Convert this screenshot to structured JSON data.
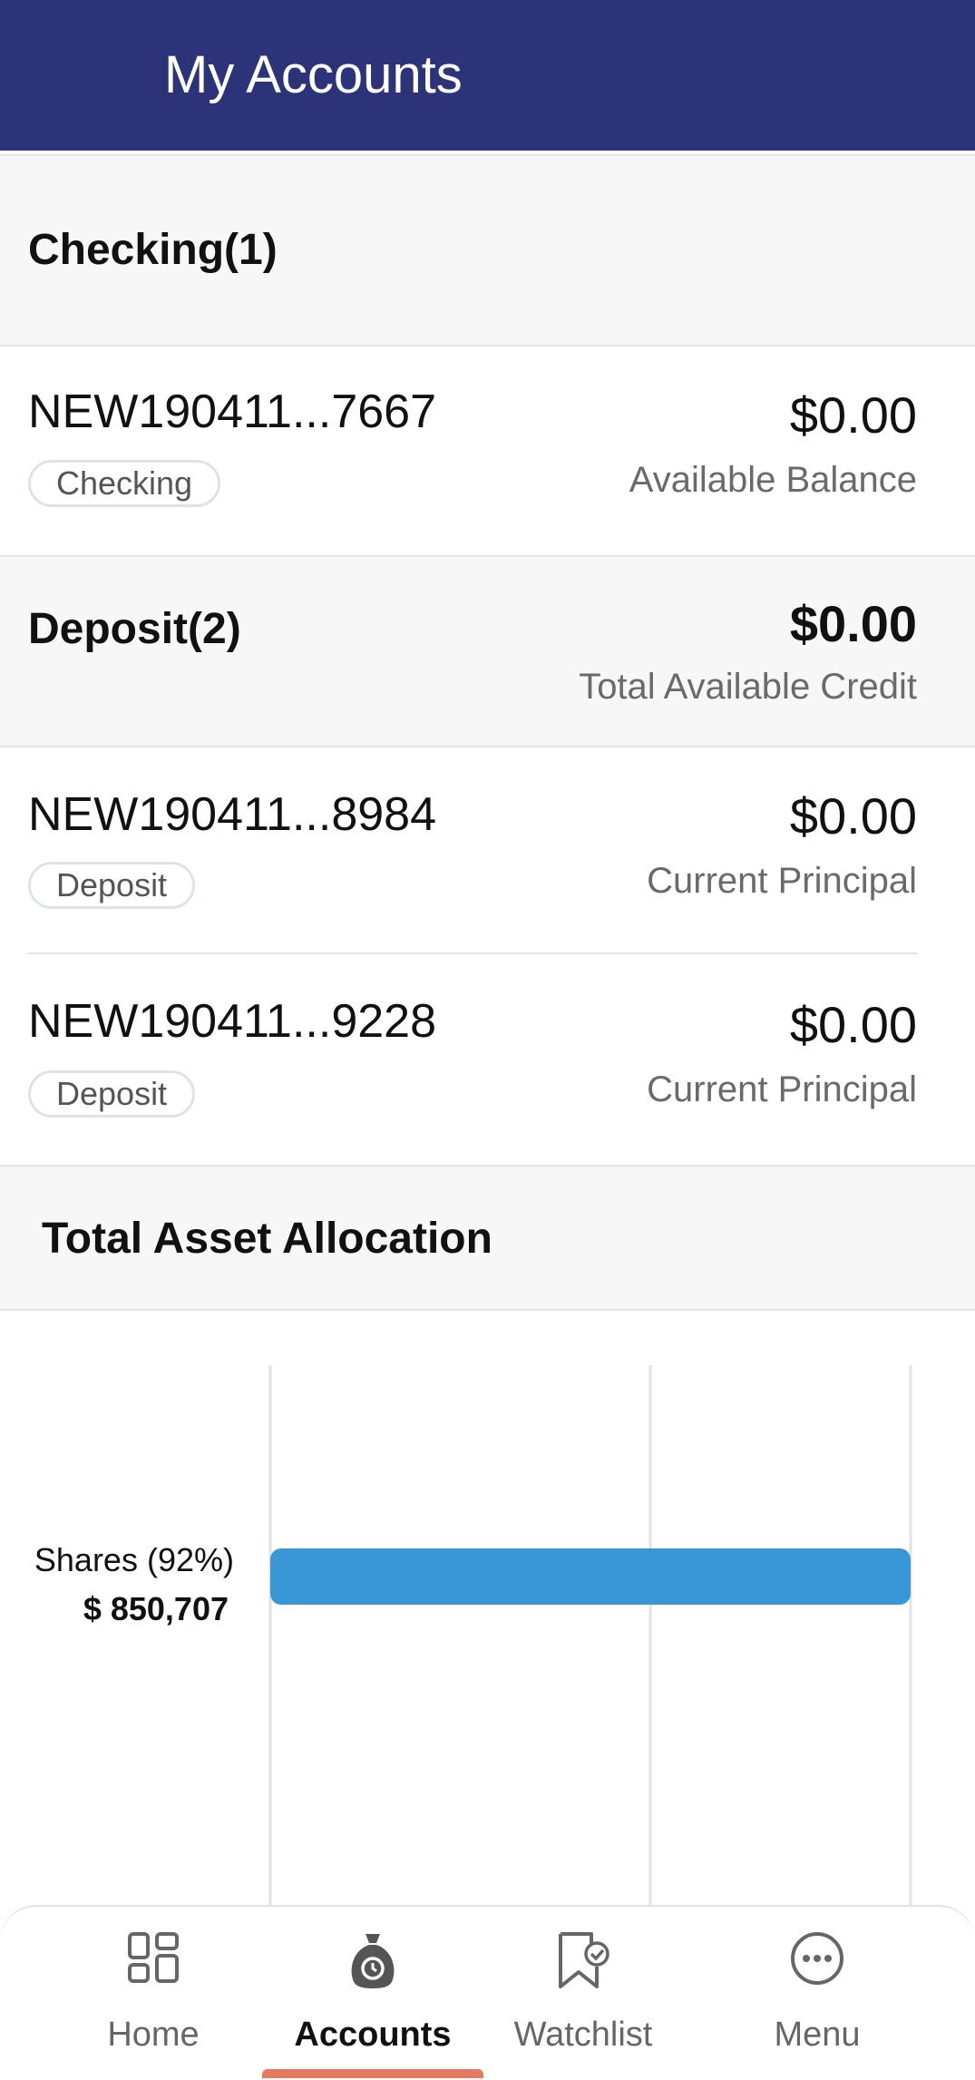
{
  "header": {
    "title": "My Accounts"
  },
  "checking": {
    "title": "Checking(1)",
    "accounts": [
      {
        "name": "NEW190411...7667",
        "tag": "Checking",
        "amount": "$0.00",
        "amount_label": "Available Balance"
      }
    ]
  },
  "deposit": {
    "title": "Deposit(2)",
    "total": "$0.00",
    "total_label": "Total Available Credit",
    "accounts": [
      {
        "name": "NEW190411...8984",
        "tag": "Deposit",
        "amount": "$0.00",
        "amount_label": "Current Principal"
      },
      {
        "name": "NEW190411...9228",
        "tag": "Deposit",
        "amount": "$0.00",
        "amount_label": "Current Principal"
      }
    ]
  },
  "allocation": {
    "title": "Total Asset Allocation"
  },
  "chart_data": {
    "type": "bar",
    "orientation": "horizontal",
    "categories": [
      "Shares (92%)"
    ],
    "values": [
      850707
    ],
    "value_labels": [
      "$ 850,707"
    ],
    "grid": true
  },
  "colors": {
    "header": "#2c3378",
    "bar": "#3a97d6",
    "nav_indicator": "#e57a5e"
  },
  "nav": {
    "items": [
      {
        "label": "Home",
        "icon": "home-grid-icon"
      },
      {
        "label": "Accounts",
        "icon": "money-bag-icon",
        "active": true
      },
      {
        "label": "Watchlist",
        "icon": "bookmark-check-icon"
      },
      {
        "label": "Menu",
        "icon": "more-circle-icon"
      }
    ]
  }
}
